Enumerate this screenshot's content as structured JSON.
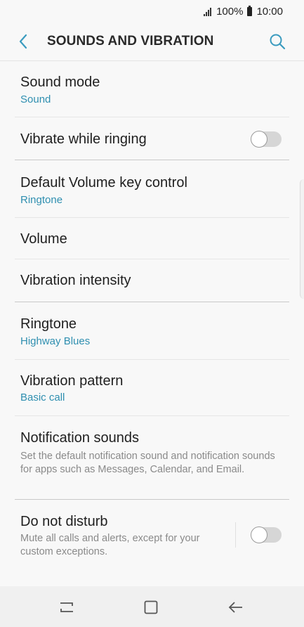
{
  "status_bar": {
    "battery": "100%",
    "time": "10:00"
  },
  "header": {
    "title": "SOUNDS AND VIBRATION",
    "back_icon": "chevron-left-icon",
    "search_icon": "search-icon"
  },
  "items": [
    {
      "label": "Sound mode",
      "value": "Sound"
    },
    {
      "label": "Vibrate while ringing",
      "toggle": "off"
    },
    {
      "label": "Default Volume key control",
      "value": "Ringtone"
    },
    {
      "label": "Volume"
    },
    {
      "label": "Vibration intensity"
    },
    {
      "label": "Ringtone",
      "value": "Highway Blues"
    },
    {
      "label": "Vibration pattern",
      "value": "Basic call"
    },
    {
      "label": "Notification sounds",
      "description": "Set the default notification sound and notification sounds for apps such as Messages, Calendar, and Email."
    },
    {
      "label": "Do not disturb",
      "description": "Mute all calls and alerts, except for your custom exceptions.",
      "toggle": "off"
    }
  ],
  "nav_bar": {
    "recents_icon": "recents-icon",
    "home_icon": "home-icon",
    "back_icon": "back-arrow-icon"
  },
  "colors": {
    "accent": "#2f8fb0",
    "background": "#f8f8f8"
  }
}
